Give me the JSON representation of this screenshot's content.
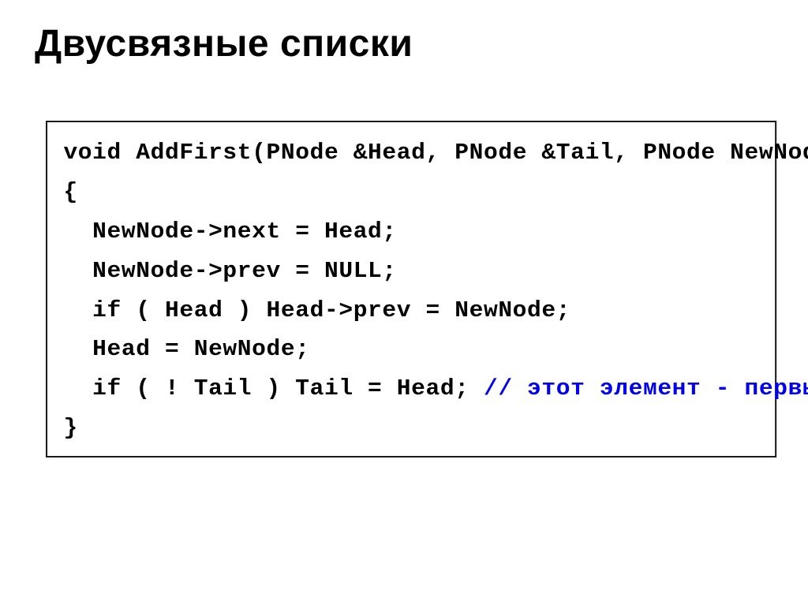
{
  "slide": {
    "title": "Двусвязные списки"
  },
  "code": {
    "line1": "void AddFirst(PNode &Head, PNode &Tail, PNode NewNode)",
    "line2": "{",
    "line3": "NewNode->next = Head;",
    "line4": "NewNode->prev = NULL;",
    "line5": "if ( Head ) Head->prev = NewNode;",
    "line6": "Head = NewNode;",
    "line7a": "if ( ! Tail ) Tail = Head; ",
    "line7b": "// этот элемент - первый",
    "line8": "}"
  }
}
